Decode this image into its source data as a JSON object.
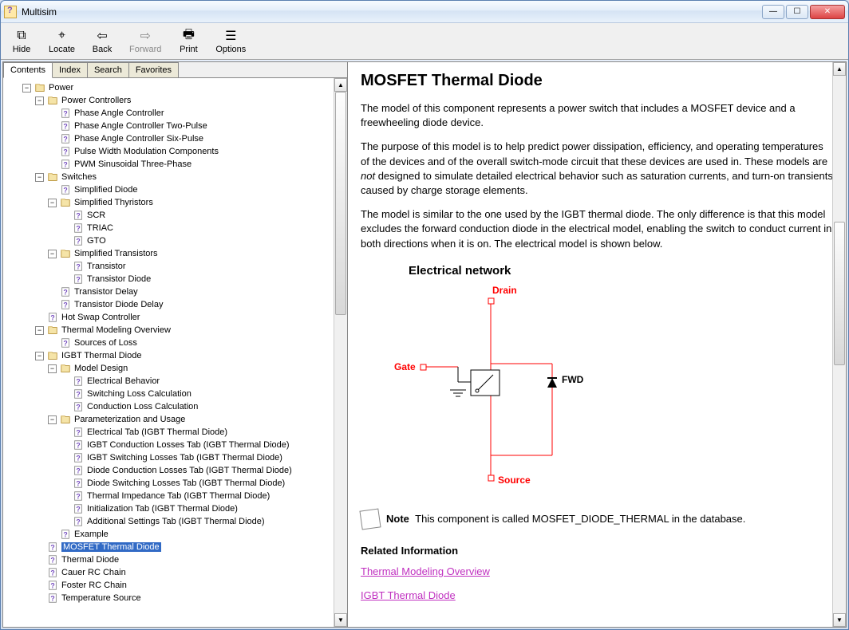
{
  "window": {
    "title": "Multisim"
  },
  "toolbar": {
    "hide": "Hide",
    "locate": "Locate",
    "back": "Back",
    "forward": "Forward",
    "print": "Print",
    "options": "Options"
  },
  "tabs": {
    "contents": "Contents",
    "index": "Index",
    "search": "Search",
    "favorites": "Favorites"
  },
  "tree": {
    "power": "Power",
    "power_controllers": "Power Controllers",
    "phase_angle": "Phase Angle Controller",
    "phase_two": "Phase Angle Controller Two-Pulse",
    "phase_six": "Phase Angle Controller Six-Pulse",
    "pwm_comp": "Pulse Width Modulation Components",
    "pwm_sin": "PWM Sinusoidal Three-Phase",
    "switches": "Switches",
    "simp_diode": "Simplified Diode",
    "simp_thy": "Simplified Thyristors",
    "scr": "SCR",
    "triac": "TRIAC",
    "gto": "GTO",
    "simp_trans": "Simplified Transistors",
    "transistor": "Transistor",
    "trans_diode": "Transistor Diode",
    "trans_delay": "Transistor Delay",
    "trans_diode_delay": "Transistor Diode Delay",
    "hot_swap": "Hot Swap Controller",
    "thermal_overview": "Thermal Modeling Overview",
    "sources_loss": "Sources of Loss",
    "igbt_thermal": "IGBT Thermal Diode",
    "model_design": "Model Design",
    "elec_behavior": "Electrical Behavior",
    "switching_loss": "Switching Loss Calculation",
    "conduction_loss": "Conduction Loss Calculation",
    "param_usage": "Parameterization and Usage",
    "elec_tab": "Electrical Tab (IGBT Thermal Diode)",
    "igbt_cond": "IGBT Conduction Losses Tab (IGBT Thermal Diode)",
    "igbt_switch": "IGBT Switching Losses Tab (IGBT Thermal Diode)",
    "diode_cond": "Diode Conduction Losses Tab (IGBT Thermal Diode)",
    "diode_switch": "Diode Switching Losses Tab (IGBT Thermal Diode)",
    "thermal_imp": "Thermal Impedance Tab (IGBT Thermal Diode)",
    "init_tab": "Initialization Tab (IGBT Thermal Diode)",
    "addl_settings": "Additional Settings Tab (IGBT Thermal Diode)",
    "example": "Example",
    "mosfet_thermal": "MOSFET Thermal Diode",
    "thermal_diode": "Thermal Diode",
    "cauer": "Cauer RC Chain",
    "foster": "Foster RC Chain",
    "temp_source": "Temperature Source"
  },
  "content": {
    "heading": "MOSFET Thermal Diode",
    "p1": "The model of this component represents a power switch that includes a MOSFET device and a freewheeling diode device.",
    "p2a": "The purpose of this model is to help predict power dissipation, efficiency, and operating temperatures of the devices and of the overall switch-mode circuit that these devices are used in. These models are ",
    "p2b": "not",
    "p2c": " designed to simulate detailed electrical behavior such as saturation currents, and turn-on transients caused by charge storage elements.",
    "p3": "The model is similar to the one used by the IGBT thermal diode. The only difference is that this model excludes the forward conduction diode in the electrical model, enabling the switch to conduct current in both directions when it is on. The electrical model is shown below.",
    "diagram_title": "Electrical network",
    "diagram_drain": "Drain",
    "diagram_gate": "Gate",
    "diagram_fwd": "FWD",
    "diagram_source": "Source",
    "note_label": "Note",
    "note_text": "This component is called MOSFET_DIODE_THERMAL in the database.",
    "related_heading": "Related Information",
    "link1": "Thermal Modeling Overview",
    "link2": "IGBT Thermal Diode"
  }
}
